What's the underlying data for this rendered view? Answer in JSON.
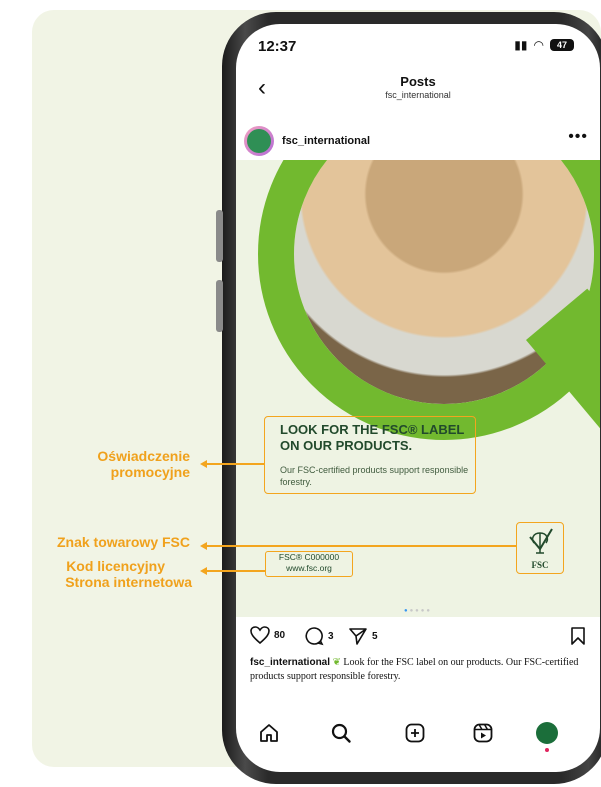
{
  "status_bar": {
    "time": "12:37",
    "battery": "47"
  },
  "header": {
    "title": "Posts",
    "subtitle": "fsc_international"
  },
  "post": {
    "username": "fsc_international",
    "promo_title": "LOOK FOR THE FSC® LABEL ON OUR PRODUCTS.",
    "promo_text": "Our FSC-certified products support responsible forestry.",
    "logo_text": "FSC",
    "license_code": "FSC® C000000",
    "license_url": "www.fsc.org",
    "likes": "80",
    "comments": "3",
    "shares": "5",
    "caption_user": "fsc_international",
    "caption_text": "Look for the FSC label on our products. Our FSC-certified products support responsible forestry."
  },
  "annotations": {
    "promo": "Oświadczenie promocyjne",
    "trademark": "Znak towarowy FSC",
    "license": "Kod licencyjny",
    "website": "Strona internetowa"
  },
  "icons": [
    "back-chevron-icon",
    "more-icon",
    "heart-icon",
    "comment-icon",
    "share-icon",
    "bookmark-icon",
    "home-icon",
    "search-icon",
    "create-icon",
    "reels-icon",
    "profile-icon"
  ],
  "colors": {
    "fsc_green": "#72b92f",
    "annotation_orange": "#f0a11c",
    "dark_green": "#224a2c"
  }
}
